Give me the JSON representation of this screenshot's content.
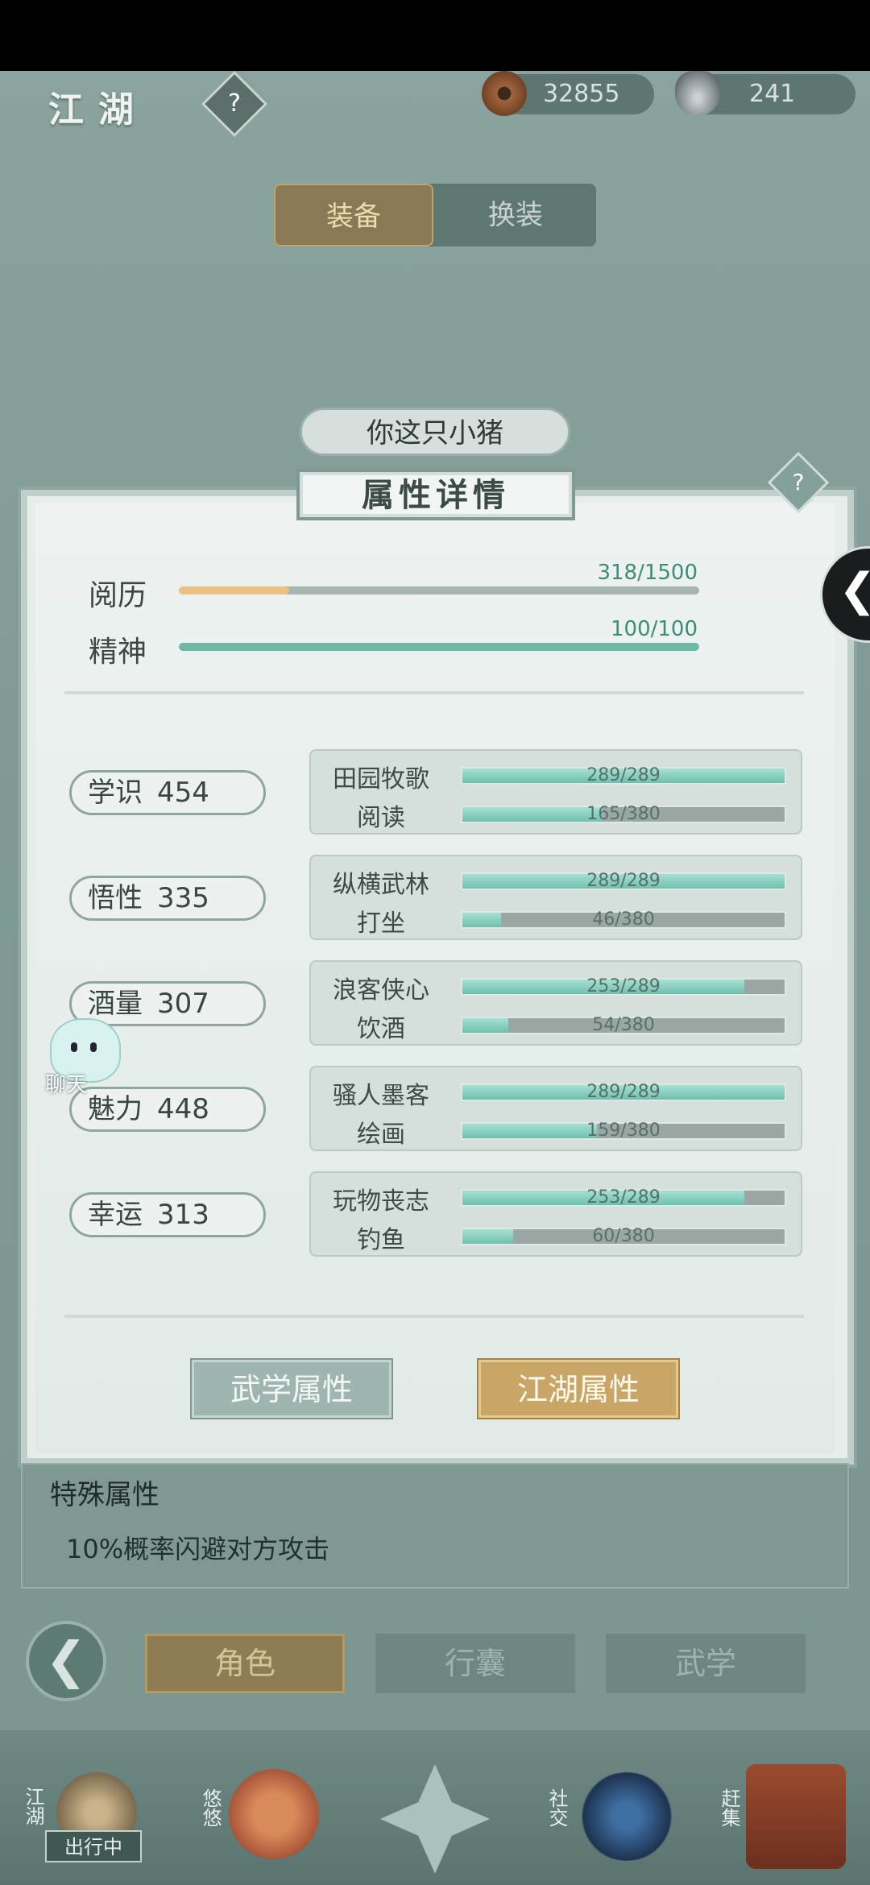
{
  "header": {
    "title": "江湖",
    "help_icon": "question-diamond-icon",
    "copper": "32855",
    "silver": "241"
  },
  "tabs": [
    {
      "label": "装备",
      "active": true
    },
    {
      "label": "换装",
      "active": false
    }
  ],
  "character": {
    "name": "你这只小猪"
  },
  "panel": {
    "title": "属性详情",
    "help": "?",
    "exp": [
      {
        "label": "阅历",
        "text": "318/1500",
        "current": 318,
        "max": 1500,
        "color": "#e8c27e"
      },
      {
        "label": "精神",
        "text": "100/100",
        "current": 100,
        "max": 100,
        "color": "#6fb8a6"
      }
    ],
    "attributes": [
      {
        "label": "学识",
        "value": "454",
        "skills": [
          {
            "name": "田园牧歌",
            "text": "289/289",
            "current": 289,
            "max": 289
          },
          {
            "name": "阅读",
            "text": "165/380",
            "current": 165,
            "max": 380
          }
        ]
      },
      {
        "label": "悟性",
        "value": "335",
        "skills": [
          {
            "name": "纵横武林",
            "text": "289/289",
            "current": 289,
            "max": 289
          },
          {
            "name": "打坐",
            "text": "46/380",
            "current": 46,
            "max": 380
          }
        ]
      },
      {
        "label": "酒量",
        "value": "307",
        "skills": [
          {
            "name": "浪客侠心",
            "text": "253/289",
            "current": 253,
            "max": 289
          },
          {
            "name": "饮酒",
            "text": "54/380",
            "current": 54,
            "max": 380
          }
        ]
      },
      {
        "label": "魅力",
        "value": "448",
        "skills": [
          {
            "name": "骚人墨客",
            "text": "289/289",
            "current": 289,
            "max": 289
          },
          {
            "name": "绘画",
            "text": "159/380",
            "current": 159,
            "max": 380
          }
        ]
      },
      {
        "label": "幸运",
        "value": "313",
        "skills": [
          {
            "name": "玩物丧志",
            "text": "253/289",
            "current": 253,
            "max": 289
          },
          {
            "name": "钓鱼",
            "text": "60/380",
            "current": 60,
            "max": 380
          }
        ]
      }
    ],
    "buttons": {
      "martial": "武学属性",
      "jianghu": "江湖属性"
    }
  },
  "chat": {
    "label": "聊天"
  },
  "special": {
    "heading": "特殊属性",
    "desc": "10%概率闪避对方攻击"
  },
  "nav": {
    "role": "角色",
    "bag": "行囊",
    "wuxue": "武学"
  },
  "bottom": {
    "jianghu": "江湖",
    "busy": "出行中",
    "youyou": "悠悠",
    "social": "社交",
    "market": "赶集"
  }
}
